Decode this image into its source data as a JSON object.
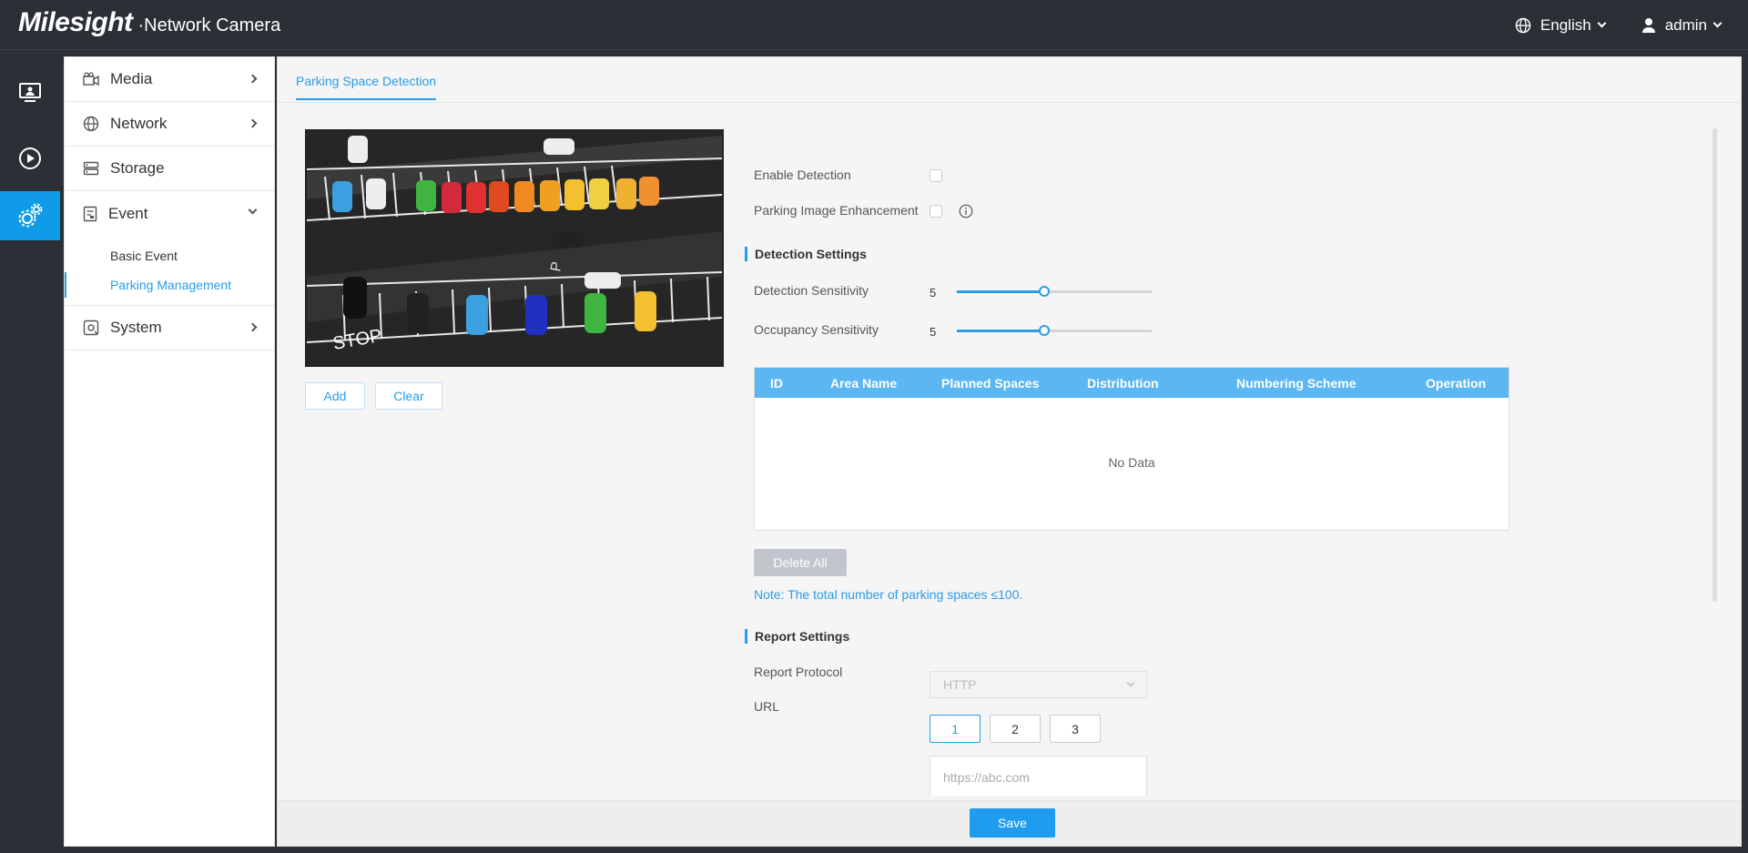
{
  "header": {
    "logo": "Milesight",
    "product": "·Network Camera",
    "language": "English",
    "user": "admin"
  },
  "rail": [
    {
      "icon": "live-view-icon"
    },
    {
      "icon": "playback-icon"
    },
    {
      "icon": "settings-icon",
      "active": true
    }
  ],
  "sidebar": {
    "items": [
      {
        "label": "Media",
        "icon": "media-icon"
      },
      {
        "label": "Network",
        "icon": "globe-icon"
      },
      {
        "label": "Storage",
        "icon": "storage-icon"
      },
      {
        "label": "Event",
        "icon": "event-icon"
      },
      {
        "label": "System",
        "icon": "system-icon"
      }
    ],
    "event_sub": [
      "Basic Event",
      "Parking Management"
    ]
  },
  "main": {
    "tab": "Parking Space Detection",
    "add_label": "Add",
    "clear_label": "Clear",
    "enable_detection": "Enable Detection",
    "parking_enhancement": "Parking Image Enhancement",
    "detection_settings_title": "Detection Settings",
    "detection_sensitivity": {
      "label": "Detection Sensitivity",
      "value": "5",
      "fraction": 0.45
    },
    "occupancy_sensitivity": {
      "label": "Occupancy Sensitivity",
      "value": "5",
      "fraction": 0.45
    },
    "table": {
      "columns": [
        "ID",
        "Area Name",
        "Planned Spaces",
        "Distribution",
        "Numbering Scheme",
        "Operation"
      ],
      "empty": "No Data"
    },
    "delete_all": "Delete All",
    "note": "Note: The total number of parking spaces ≤100.",
    "report_settings_title": "Report Settings",
    "report_protocol": {
      "label": "Report Protocol",
      "value": "HTTP"
    },
    "url": {
      "label": "URL",
      "buttons": [
        "1",
        "2",
        "3"
      ],
      "placeholder": "https://abc.com"
    },
    "save": "Save"
  },
  "colors": {
    "accent": "#2a9ce8",
    "header_bg": "#2b2f36",
    "table_header": "#5cb6f2"
  }
}
